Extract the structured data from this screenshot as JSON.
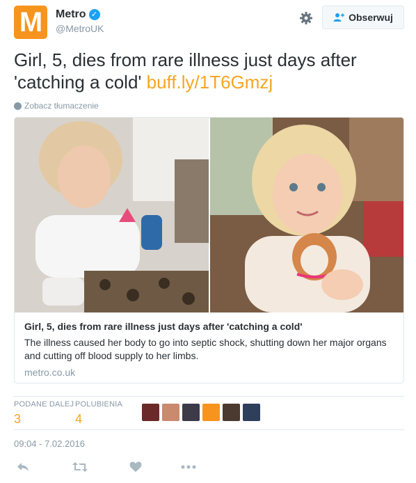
{
  "header": {
    "avatar_letter": "M",
    "name": "Metro",
    "handle": "@MetroUK",
    "follow_label": "Obserwuj"
  },
  "tweet": {
    "text": "Girl, 5, dies from rare illness just days after 'catching a cold'",
    "link": "buff.ly/1T6Gmzj",
    "translate_label": "Zobacz tłumaczenie"
  },
  "card": {
    "title": "Girl, 5, dies from rare illness just days after 'catching a cold'",
    "description": "The illness caused her body to go into septic shock, shutting down her major organs and cutting off blood supply to her limbs.",
    "domain": "metro.co.uk"
  },
  "stats": {
    "retweets_label": "PODANE DALEJ",
    "retweets_value": "3",
    "likes_label": "POLUBIENIA",
    "likes_value": "4"
  },
  "timestamp": "09:04 - 7.02.2016",
  "colors": {
    "brand": "#f7941d",
    "accent": "#f5a623",
    "verified": "#1da1f2"
  }
}
